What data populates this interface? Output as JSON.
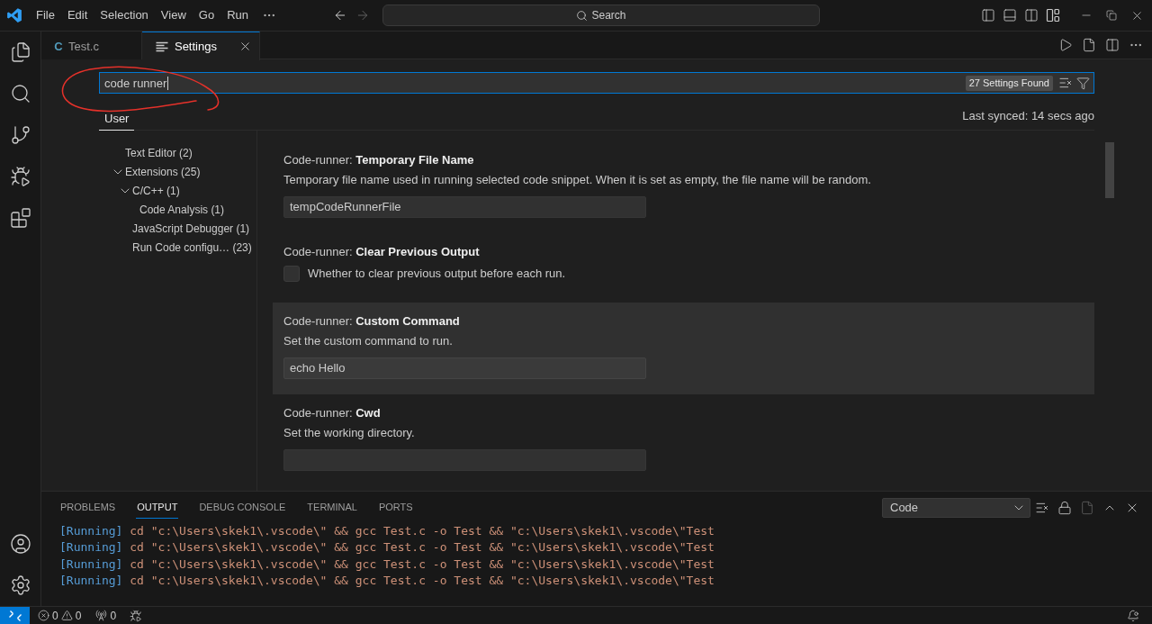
{
  "title_bar": {
    "menu": [
      "File",
      "Edit",
      "Selection",
      "View",
      "Go",
      "Run"
    ],
    "nav": [
      {
        "kind": "back",
        "disabled": false
      },
      {
        "kind": "forward",
        "disabled": true
      }
    ],
    "command_center": "Search"
  },
  "editor_tabs": [
    {
      "kind": "file",
      "icon_text": "C",
      "label": "Test.c",
      "selected": false
    },
    {
      "kind": "settings",
      "label": "Settings",
      "selected": true
    }
  ],
  "settings_search": {
    "value": "code runner",
    "results": "27 Settings Found"
  },
  "scope_tabs": [
    {
      "label": "User",
      "selected": true
    }
  ],
  "last_synced": "Last synced: 14 secs ago",
  "toc": [
    {
      "label": "Text Editor (2)"
    },
    {
      "label": "Extensions (25)",
      "expanded": true,
      "children": [
        {
          "label": "C/C++ (1)",
          "expanded": true,
          "children": [
            {
              "label": "Code Analysis (1)"
            }
          ]
        },
        {
          "label": "JavaScript Debugger (1)"
        },
        {
          "label": "Run Code configu… (23)"
        }
      ]
    }
  ],
  "settings": [
    {
      "kind": "text",
      "title": "Code-runner: **Temporary File Name**",
      "description": "Temporary file name used in running selected code snippet. When it is set as empty, the file name will be random.",
      "value": "tempCodeRunnerFile",
      "focused": false
    },
    {
      "kind": "checkbox",
      "title": "Code-runner: **Clear Previous Output**",
      "description": "Whether to clear previous output before each run.",
      "checked": false,
      "focused": false
    },
    {
      "kind": "text",
      "title": "Code-runner: **Custom Command**",
      "description": "Set the custom command to run.",
      "value": "echo Hello",
      "focused": true
    },
    {
      "kind": "text",
      "title": "Code-runner: **Cwd**",
      "description": "Set the working directory.",
      "focused": false
    }
  ],
  "panel": {
    "tabs": [
      {
        "label": "PROBLEMS",
        "selected": false
      },
      {
        "label": "OUTPUT",
        "selected": true
      },
      {
        "label": "DEBUG CONSOLE",
        "selected": false
      },
      {
        "label": "TERMINAL",
        "selected": false
      },
      {
        "label": "PORTS",
        "selected": false
      }
    ],
    "channel": "Code",
    "actions": [
      {
        "kind": "clear",
        "disabled": false
      },
      {
        "kind": "lock",
        "disabled": false
      },
      {
        "kind": "open",
        "disabled": true
      },
      {
        "kind": "maximize",
        "disabled": false
      },
      {
        "kind": "close",
        "disabled": false
      }
    ],
    "output": [
      {
        "tag": "[Running]",
        "text": "cd \"c:\\Users\\skek1\\.vscode\\\" && gcc Test.c -o Test && \"c:\\Users\\skek1\\.vscode\\\"Test"
      },
      {
        "tag": "[Running]",
        "text": "cd \"c:\\Users\\skek1\\.vscode\\\" && gcc Test.c -o Test && \"c:\\Users\\skek1\\.vscode\\\"Test"
      },
      {
        "tag": "[Running]",
        "text": "cd \"c:\\Users\\skek1\\.vscode\\\" && gcc Test.c -o Test && \"c:\\Users\\skek1\\.vscode\\\"Test"
      },
      {
        "tag": "[Running]",
        "text": "cd \"c:\\Users\\skek1\\.vscode\\\" && gcc Test.c -o Test && \"c:\\Users\\skek1\\.vscode\\\"Test"
      }
    ]
  },
  "status_bar": {
    "errors": "0",
    "warnings": "0",
    "ports": "0"
  }
}
